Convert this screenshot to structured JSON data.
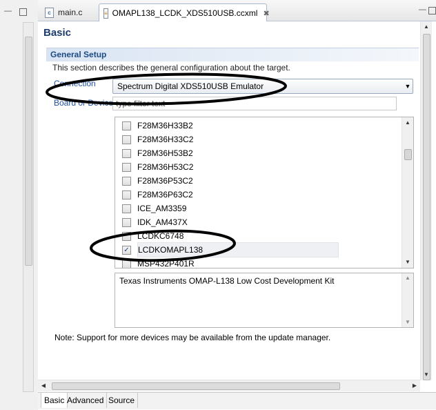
{
  "tabs": [
    {
      "label": "main.c",
      "icon": "c-source-file-icon"
    },
    {
      "label": "OMAPL138_LCDK_XDS510USB.ccxml",
      "icon": "ccxml-file-icon"
    }
  ],
  "page": {
    "title": "Basic"
  },
  "general_setup": {
    "title": "General Setup",
    "description": "This section describes the general configuration about the target."
  },
  "connection": {
    "label": "Connection",
    "value": "Spectrum Digital XDS510USB Emulator"
  },
  "board": {
    "label": "Board or Device",
    "filter_placeholder": "type filter text"
  },
  "devices": [
    {
      "name": "F28M36H33B2",
      "checked": false
    },
    {
      "name": "F28M36H33C2",
      "checked": false
    },
    {
      "name": "F28M36H53B2",
      "checked": false
    },
    {
      "name": "F28M36H53C2",
      "checked": false
    },
    {
      "name": "F28M36P53C2",
      "checked": false
    },
    {
      "name": "F28M36P63C2",
      "checked": false
    },
    {
      "name": "ICE_AM3359",
      "checked": false
    },
    {
      "name": "IDK_AM437X",
      "checked": false
    },
    {
      "name": "LCDKC6748",
      "checked": false
    },
    {
      "name": "LCDKOMAPL138",
      "checked": true
    },
    {
      "name": "MSP432P401R",
      "checked": false
    }
  ],
  "device_description": "Texas Instruments OMAP-L138 Low Cost Development Kit",
  "note": "Note: Support for more devices may be available from the update manager.",
  "bottom_tabs": [
    "Basic",
    "Advanced",
    "Source"
  ],
  "colors": {
    "link": "#1f4ea0",
    "section_title": "#1c4b85",
    "page_title": "#1c3a6b",
    "annotation": "#000000"
  }
}
